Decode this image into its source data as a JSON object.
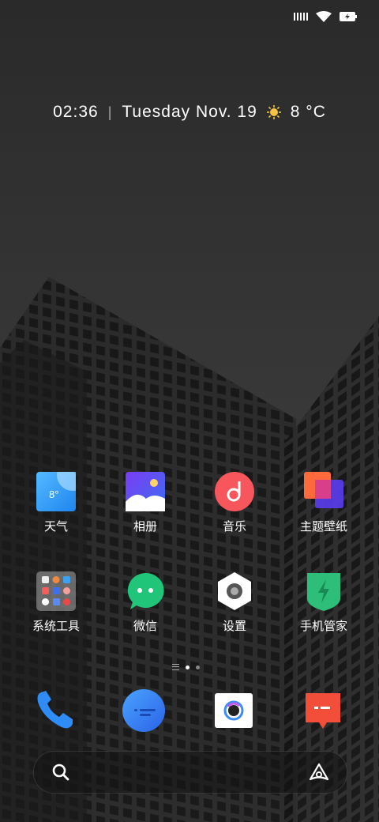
{
  "status": {
    "signal_icon": "signal-icon",
    "wifi_icon": "wifi-icon",
    "battery_icon": "battery-charging-icon"
  },
  "widget": {
    "time": "02:36",
    "date": "Tuesday Nov. 19",
    "temp": "8 °C",
    "weather_icon": "sun-icon"
  },
  "apps": [
    {
      "label": "天气",
      "icon": "weather-app-icon",
      "badge": "8°"
    },
    {
      "label": "相册",
      "icon": "gallery-app-icon"
    },
    {
      "label": "音乐",
      "icon": "music-app-icon"
    },
    {
      "label": "主题壁纸",
      "icon": "themes-app-icon"
    },
    {
      "label": "系统工具",
      "icon": "system-tools-folder-icon"
    },
    {
      "label": "微信",
      "icon": "wechat-app-icon"
    },
    {
      "label": "设置",
      "icon": "settings-app-icon"
    },
    {
      "label": "手机管家",
      "icon": "phone-manager-app-icon"
    }
  ],
  "dock": [
    {
      "icon": "phone-app-icon"
    },
    {
      "icon": "messages-app-icon"
    },
    {
      "icon": "camera-app-icon"
    },
    {
      "icon": "browser-app-icon"
    }
  ],
  "page_indicator": {
    "pages": 2,
    "current": 1
  },
  "search": {
    "left_icon": "search-icon",
    "right_icon": "assistant-icon"
  }
}
